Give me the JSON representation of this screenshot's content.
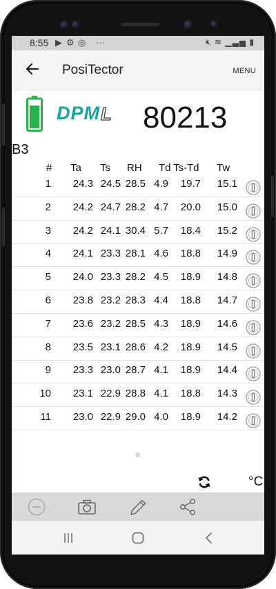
{
  "status_bar": {
    "time": "8:55",
    "left_icons": [
      "play-icon",
      "settings-icon",
      "target-icon"
    ],
    "more": "···",
    "right_icons": [
      "mute-icon",
      "wifi-icon",
      "signal-icon",
      "battery-icon"
    ]
  },
  "app_bar": {
    "title": "PosiTector",
    "menu_label": "MENU"
  },
  "device": {
    "logo_text": "DPM",
    "logo_suffix": "L",
    "serial": "80213",
    "battery_level": 0.85
  },
  "batch": "B3",
  "table": {
    "columns": [
      "#",
      "Ta",
      "Ts",
      "RH",
      "Td",
      "Ts-Td",
      "Tw"
    ],
    "rows": [
      [
        "1",
        "24.3",
        "24.5",
        "28.5",
        "4.9",
        "19.7",
        "15.1"
      ],
      [
        "2",
        "24.2",
        "24.7",
        "28.2",
        "4.7",
        "20.0",
        "15.0"
      ],
      [
        "3",
        "24.2",
        "24.1",
        "30.4",
        "5.7",
        "18.4",
        "15.2"
      ],
      [
        "4",
        "24.1",
        "23.3",
        "28.1",
        "4.6",
        "18.8",
        "14.9"
      ],
      [
        "5",
        "24.0",
        "23.3",
        "28.2",
        "4.5",
        "18.9",
        "14.8"
      ],
      [
        "6",
        "23.8",
        "23.2",
        "28.3",
        "4.4",
        "18.8",
        "14.7"
      ],
      [
        "7",
        "23.6",
        "23.2",
        "28.5",
        "4.3",
        "18.9",
        "14.6"
      ],
      [
        "8",
        "23.5",
        "23.1",
        "28.6",
        "4.2",
        "18.9",
        "14.5"
      ],
      [
        "9",
        "23.3",
        "23.0",
        "28.7",
        "4.1",
        "18.9",
        "14.4"
      ],
      [
        "10",
        "23.1",
        "22.9",
        "28.8",
        "4.1",
        "18.8",
        "14.3"
      ],
      [
        "11",
        "23.0",
        "22.9",
        "29.0",
        "4.0",
        "18.9",
        "14.2"
      ]
    ]
  },
  "unit": "°C",
  "toolbar": [
    "remove-icon",
    "camera-icon",
    "pencil-icon",
    "share-icon"
  ],
  "nav": [
    "recents-icon",
    "home-icon",
    "back-icon"
  ],
  "colors": {
    "accent": "#18a3a3",
    "battery": "#27b24a"
  }
}
